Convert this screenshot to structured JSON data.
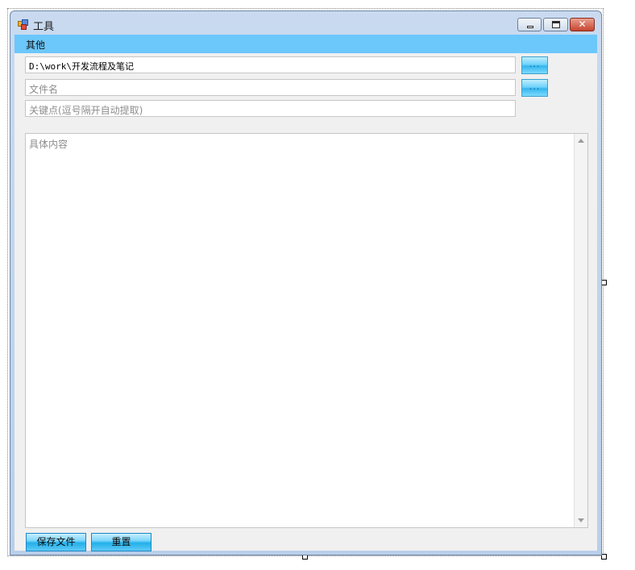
{
  "window": {
    "title": "工具",
    "icon": "app-icon"
  },
  "menubar": {
    "items": [
      {
        "label": "其他"
      }
    ]
  },
  "form": {
    "path_value": "D:\\work\\开发流程及笔记",
    "filename_placeholder": "文件名",
    "keywords_placeholder": "关键点(逗号隔开自动提取)",
    "content_placeholder": "具体内容",
    "browse_label": "...",
    "save_label": "保存文件",
    "reset_label": "重置"
  },
  "colors": {
    "menubar": "#6cc7fb",
    "button": "#22b0ea"
  }
}
